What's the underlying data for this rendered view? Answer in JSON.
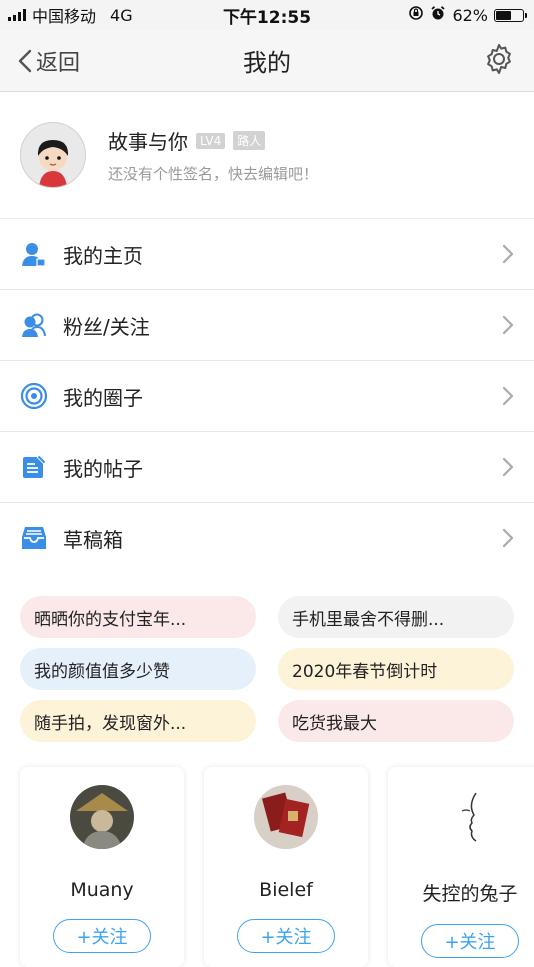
{
  "status_bar": {
    "carrier": "中国移动",
    "network": "4G",
    "time": "下午12:55",
    "battery": "62%",
    "battery_level": 0.62
  },
  "nav": {
    "back_label": "返回",
    "title": "我的",
    "settings_icon": "gear-icon"
  },
  "profile": {
    "name": "故事与你",
    "level": "LV4",
    "rank": "路人",
    "signature": "还没有个性签名，快去编辑吧！"
  },
  "menu": [
    {
      "label": "我的主页",
      "icon": "user-home-icon"
    },
    {
      "label": "粉丝/关注",
      "icon": "followers-icon"
    },
    {
      "label": "我的圈子",
      "icon": "circle-target-icon"
    },
    {
      "label": "我的帖子",
      "icon": "post-edit-icon"
    },
    {
      "label": "草稿箱",
      "icon": "drafts-tray-icon"
    }
  ],
  "topics": [
    {
      "label": "晒晒你的支付宝年...",
      "color": "#fbe9ea"
    },
    {
      "label": "手机里最舍不得删...",
      "color": "#f2f2f2"
    },
    {
      "label": "我的颜值值多少赞",
      "color": "#e5f0fb"
    },
    {
      "label": "2020年春节倒计时",
      "color": "#fdf3d8"
    },
    {
      "label": "随手拍，发现窗外...",
      "color": "#fdf3d8"
    },
    {
      "label": "吃货我最大",
      "color": "#fbe9ea"
    }
  ],
  "users": [
    {
      "name": "Muany",
      "follow_label": "+关注"
    },
    {
      "name": "Bielef",
      "follow_label": "+关注"
    },
    {
      "name": "失控的兔子",
      "follow_label": "+关注"
    }
  ],
  "colors": {
    "accent": "#3da3ed",
    "icon_blue": "#3a8ee6"
  }
}
